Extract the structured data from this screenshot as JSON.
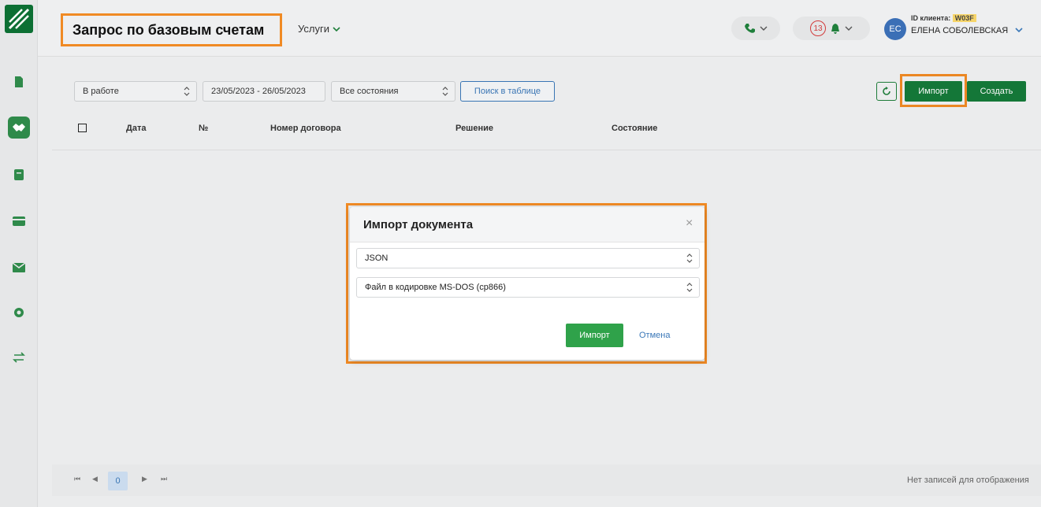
{
  "header": {
    "title": "Запрос по базовым счетам",
    "services_label": "Услуги",
    "notifications_count": "13",
    "avatar_initials": "ЕС",
    "client_id_label": "ID клиента:",
    "client_id_value": "W03F",
    "user_name": "ЕЛЕНА СОБОЛЕВСКАЯ"
  },
  "toolbar": {
    "status_filter": "В работе",
    "date_range": "23/05/2023 - 26/05/2023",
    "state_filter": "Все состояния",
    "search_label": "Поиск в таблице",
    "import_label": "Импорт",
    "create_label": "Создать"
  },
  "table": {
    "columns": [
      "Дата",
      "№",
      "Номер договора",
      "Решение",
      "Состояние"
    ]
  },
  "pagination": {
    "current_page": "0",
    "empty_text": "Нет записей для отображения"
  },
  "modal": {
    "title": "Импорт документа",
    "format_value": "JSON",
    "encoding_value": "Файл в кодировке MS-DOS (cp866)",
    "import_label": "Импорт",
    "cancel_label": "Отмена",
    "close_symbol": "×"
  },
  "colors": {
    "primary_green": "#157a3a",
    "accent_orange": "#f08a24",
    "link_blue": "#3b78b8"
  }
}
